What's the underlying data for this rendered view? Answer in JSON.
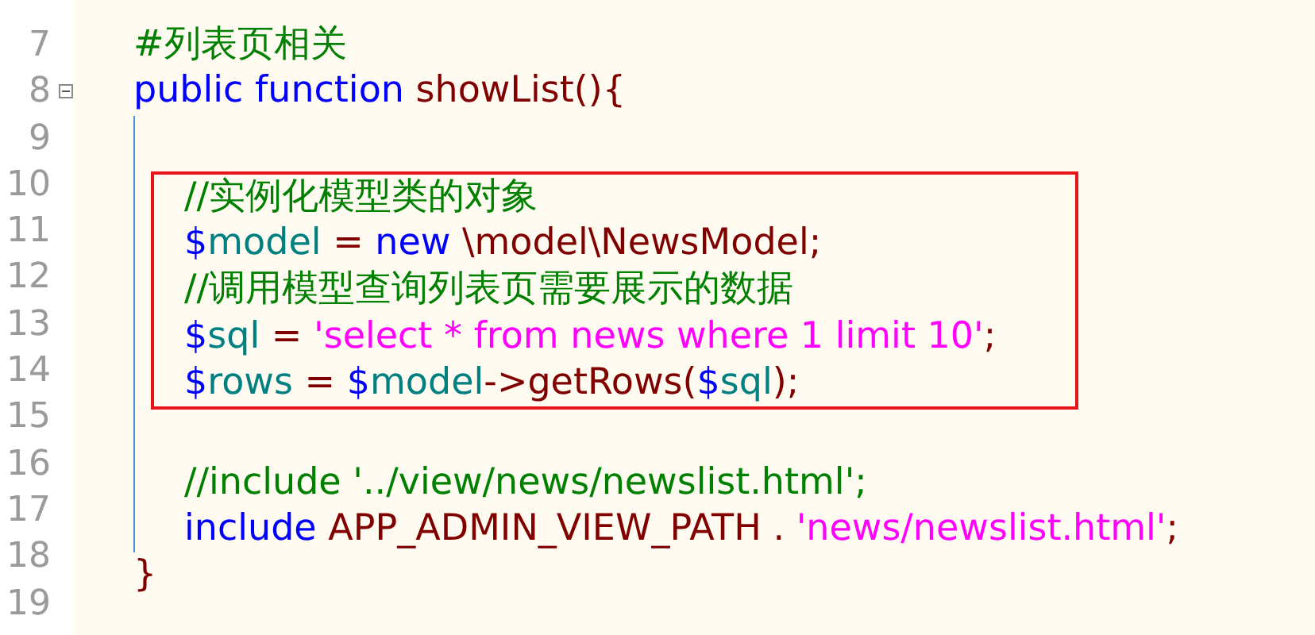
{
  "editor": {
    "lines": [
      {
        "number": "7",
        "highlighted": false,
        "tokens": [
          {
            "kind": "comment",
            "text": "#列表页相关"
          }
        ]
      },
      {
        "number": "8",
        "highlighted": false,
        "expanded": true,
        "tokens": [
          {
            "kind": "keyword",
            "text": "public function"
          },
          {
            "kind": "identifier",
            "text": " showList(){"
          }
        ],
        "children": [
          {
            "number": "9",
            "highlighted": false
          },
          {
            "number": "10",
            "highlighted": true,
            "tokens": [
              {
                "kind": "comment",
                "text": "//实例化模型类的对象"
              }
            ]
          },
          {
            "number": "11",
            "highlighted": true,
            "tokens": [
              {
                "kind": "sigil",
                "text": "$"
              },
              {
                "kind": "variable",
                "text": "model"
              },
              {
                "kind": "identifier",
                "text": " = "
              },
              {
                "kind": "keyword",
                "text": "new"
              },
              {
                "kind": "identifier",
                "text": " \\model\\NewsModel;"
              }
            ]
          },
          {
            "number": "12",
            "highlighted": true,
            "tokens": [
              {
                "kind": "comment",
                "text": "//调用模型查询列表页需要展示的数据"
              }
            ]
          },
          {
            "number": "13",
            "highlighted": true,
            "tokens": [
              {
                "kind": "sigil",
                "text": "$"
              },
              {
                "kind": "variable",
                "text": "sql"
              },
              {
                "kind": "identifier",
                "text": " = "
              },
              {
                "kind": "string",
                "text": "'select * from news where 1 limit 10'"
              },
              {
                "kind": "identifier",
                "text": ";"
              }
            ]
          },
          {
            "number": "14",
            "highlighted": true,
            "tokens": [
              {
                "kind": "sigil",
                "text": "$"
              },
              {
                "kind": "variable",
                "text": "rows"
              },
              {
                "kind": "identifier",
                "text": " = "
              },
              {
                "kind": "sigil",
                "text": "$"
              },
              {
                "kind": "variable",
                "text": "model"
              },
              {
                "kind": "identifier",
                "text": "->getRows("
              },
              {
                "kind": "sigil",
                "text": "$"
              },
              {
                "kind": "variable",
                "text": "sql"
              },
              {
                "kind": "identifier",
                "text": ");"
              }
            ]
          },
          {
            "number": "15",
            "highlighted": false
          },
          {
            "number": "16",
            "highlighted": false,
            "tokens": [
              {
                "kind": "comment",
                "text": "//include '../view/news/newslist.html';"
              }
            ]
          },
          {
            "number": "17",
            "highlighted": false,
            "tokens": [
              {
                "kind": "keyword",
                "text": "include"
              },
              {
                "kind": "identifier",
                "text": " APP_ADMIN_VIEW_PATH . "
              },
              {
                "kind": "string",
                "text": "'news/newslist.html'"
              },
              {
                "kind": "identifier",
                "text": ";"
              }
            ]
          }
        ]
      },
      {
        "number": "18",
        "highlighted": false,
        "tokens": [
          {
            "kind": "identifier",
            "text": "}"
          }
        ]
      },
      {
        "number": "19",
        "highlighted": false
      }
    ]
  }
}
